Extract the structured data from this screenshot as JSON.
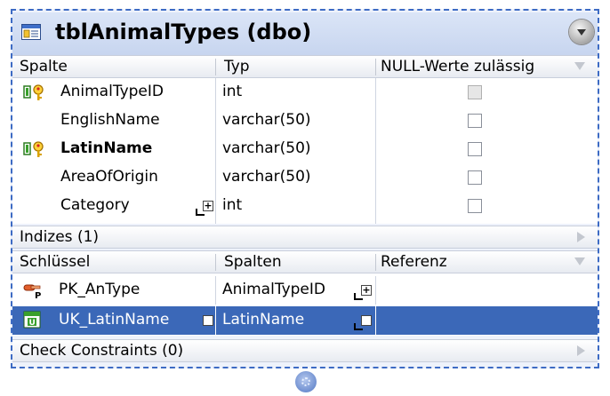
{
  "table": {
    "title": "tblAnimalTypes (dbo)"
  },
  "columns_section": {
    "headers": [
      "Spalte",
      "Typ",
      "NULL-Werte zulässig"
    ],
    "rows": [
      {
        "name": "AnimalTypeID",
        "type": "int",
        "nullable": false,
        "nullable_disabled": true,
        "key": "primary",
        "bold": false
      },
      {
        "name": "EnglishName",
        "type": "varchar(50)",
        "nullable": false,
        "nullable_disabled": false,
        "key": "",
        "bold": false
      },
      {
        "name": "LatinName",
        "type": "varchar(50)",
        "nullable": false,
        "nullable_disabled": false,
        "key": "unique",
        "bold": true
      },
      {
        "name": "AreaOfOrigin",
        "type": "varchar(50)",
        "nullable": false,
        "nullable_disabled": false,
        "key": "",
        "bold": false
      },
      {
        "name": "Category",
        "type": "int",
        "nullable": false,
        "nullable_disabled": false,
        "key": "",
        "bold": false
      }
    ]
  },
  "indexes_section": {
    "label": "Indizes (1)"
  },
  "keys_section": {
    "headers": [
      "Schlüssel",
      "Spalten",
      "Referenz"
    ],
    "rows": [
      {
        "name": "PK_AnType",
        "columns": "AnimalTypeID",
        "reference": "",
        "selected": false,
        "icon": "primary-key-icon"
      },
      {
        "name": "UK_LatinName",
        "columns": "LatinName",
        "reference": "",
        "selected": true,
        "icon": "unique-key-icon"
      }
    ]
  },
  "check_constraints_section": {
    "label": "Check Constraints (0)"
  },
  "colors": {
    "frame_border": "#3d6bc4",
    "selected_row": "#3b68b8",
    "title_bar": "#c7d5ef"
  }
}
